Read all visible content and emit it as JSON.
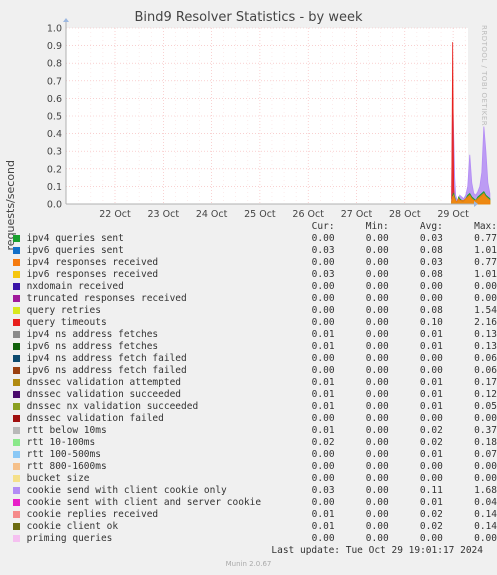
{
  "chart_data": {
    "type": "area",
    "title": "Bind9 Resolver Statistics - by week",
    "ylabel": "requests/second",
    "xlabel": "",
    "ylim": [
      0,
      1.0
    ],
    "y_ticks": [
      "0.0",
      "0.1",
      "0.2",
      "0.3",
      "0.4",
      "0.5",
      "0.6",
      "0.7",
      "0.8",
      "0.9",
      "1.0"
    ],
    "x_ticks": [
      "22 Oct",
      "23 Oct",
      "24 Oct",
      "25 Oct",
      "26 Oct",
      "27 Oct",
      "28 Oct",
      "29 Oct"
    ],
    "grid": true,
    "colors": {
      "background": "#f0f0f0",
      "plot_background": "#ffffff",
      "grid": "#f5b5b5",
      "axis": "#b0b0b0"
    },
    "x": [
      "29 Oct 00:00",
      "29 Oct 00:30",
      "29 Oct 01:00",
      "29 Oct 01:30",
      "29 Oct 02:00",
      "29 Oct 02:30",
      "29 Oct 03:00",
      "29 Oct 03:30",
      "29 Oct 04:00",
      "29 Oct 05:00",
      "29 Oct 06:00",
      "29 Oct 07:00",
      "29 Oct 08:00",
      "29 Oct 09:00",
      "29 Oct 10:00",
      "29 Oct 11:00",
      "29 Oct 12:00",
      "29 Oct 13:00",
      "29 Oct 14:00",
      "29 Oct 15:00",
      "29 Oct 16:00",
      "29 Oct 17:00",
      "29 Oct 18:00",
      "29 Oct 19:00"
    ],
    "series": [
      {
        "name": "cookie send with client cookie only",
        "color": "#b38cf5",
        "values": [
          0.08,
          0.62,
          0.4,
          0.15,
          0.05,
          0.03,
          0.02,
          0.03,
          0.05,
          0.04,
          0.03,
          0.05,
          0.1,
          0.28,
          0.12,
          0.06,
          0.05,
          0.07,
          0.1,
          0.18,
          0.44,
          0.3,
          0.12,
          0.06
        ]
      },
      {
        "name": "query timeouts",
        "color": "#e8201c",
        "values": [
          0.0,
          0.92,
          0.1,
          0.0,
          0.0,
          0.0,
          0.0,
          0.0,
          0.0,
          0.0,
          0.0,
          0.0,
          0.0,
          0.0,
          0.0,
          0.0,
          0.0,
          0.0,
          0.0,
          0.0,
          0.0,
          0.0,
          0.0,
          0.0
        ]
      },
      {
        "name": "ipv4 queries sent",
        "color": "#18a02e",
        "values": [
          0.01,
          0.05,
          0.06,
          0.04,
          0.02,
          0.01,
          0.02,
          0.04,
          0.03,
          0.02,
          0.02,
          0.03,
          0.05,
          0.06,
          0.04,
          0.03,
          0.02,
          0.04,
          0.05,
          0.06,
          0.07,
          0.05,
          0.04,
          0.03
        ]
      },
      {
        "name": "query retries",
        "color": "#d8e81e",
        "values": [
          0.01,
          0.04,
          0.03,
          0.02,
          0.01,
          0.01,
          0.01,
          0.02,
          0.02,
          0.01,
          0.01,
          0.02,
          0.03,
          0.04,
          0.03,
          0.02,
          0.01,
          0.02,
          0.03,
          0.04,
          0.05,
          0.04,
          0.03,
          0.02
        ]
      },
      {
        "name": "ipv4 responses received",
        "color": "#f57a0e",
        "values": [
          0.01,
          0.04,
          0.05,
          0.03,
          0.02,
          0.01,
          0.02,
          0.03,
          0.02,
          0.02,
          0.02,
          0.03,
          0.04,
          0.05,
          0.03,
          0.02,
          0.02,
          0.03,
          0.04,
          0.05,
          0.06,
          0.04,
          0.03,
          0.02
        ]
      }
    ],
    "legend": {
      "headers": [
        "Cur:",
        "Min:",
        "Avg:",
        "Max:"
      ],
      "rows": [
        {
          "name": "ipv4 queries sent",
          "color": "#18a02e",
          "cur": "0.00",
          "min": "0.00",
          "avg": "0.03",
          "max": "0.77"
        },
        {
          "name": "ipv6 queries sent",
          "color": "#1270c8",
          "cur": "0.03",
          "min": "0.00",
          "avg": "0.08",
          "max": "1.01"
        },
        {
          "name": "ipv4 responses received",
          "color": "#f57a0e",
          "cur": "0.00",
          "min": "0.00",
          "avg": "0.03",
          "max": "0.77"
        },
        {
          "name": "ipv6 responses received",
          "color": "#f5c60e",
          "cur": "0.03",
          "min": "0.00",
          "avg": "0.08",
          "max": "1.01"
        },
        {
          "name": "nxdomain received",
          "color": "#3a14a8",
          "cur": "0.00",
          "min": "0.00",
          "avg": "0.00",
          "max": "0.00"
        },
        {
          "name": "truncated responses received",
          "color": "#a01a9a",
          "cur": "0.00",
          "min": "0.00",
          "avg": "0.00",
          "max": "0.00"
        },
        {
          "name": "query retries",
          "color": "#d8e81e",
          "cur": "0.00",
          "min": "0.00",
          "avg": "0.08",
          "max": "1.54"
        },
        {
          "name": "query timeouts",
          "color": "#e8201c",
          "cur": "0.00",
          "min": "0.00",
          "avg": "0.10",
          "max": "2.16"
        },
        {
          "name": "ipv4 ns address fetches",
          "color": "#8a8a8a",
          "cur": "0.01",
          "min": "0.00",
          "avg": "0.01",
          "max": "0.13"
        },
        {
          "name": "ipv6 ns address fetches",
          "color": "#10600a",
          "cur": "0.01",
          "min": "0.00",
          "avg": "0.01",
          "max": "0.13"
        },
        {
          "name": "ipv4 ns address fetch failed",
          "color": "#0c4a6e",
          "cur": "0.00",
          "min": "0.00",
          "avg": "0.00",
          "max": "0.06"
        },
        {
          "name": "ipv6 ns address fetch failed",
          "color": "#9a4010",
          "cur": "0.00",
          "min": "0.00",
          "avg": "0.00",
          "max": "0.06"
        },
        {
          "name": "dnssec validation attempted",
          "color": "#b08a10",
          "cur": "0.01",
          "min": "0.00",
          "avg": "0.01",
          "max": "0.17"
        },
        {
          "name": "dnssec validation succeeded",
          "color": "#4a0a6a",
          "cur": "0.01",
          "min": "0.00",
          "avg": "0.01",
          "max": "0.12"
        },
        {
          "name": "dnssec nx validation succeeded",
          "color": "#8aa020",
          "cur": "0.01",
          "min": "0.00",
          "avg": "0.01",
          "max": "0.05"
        },
        {
          "name": "dnssec validation failed",
          "color": "#a01010",
          "cur": "0.00",
          "min": "0.00",
          "avg": "0.00",
          "max": "0.00"
        },
        {
          "name": "rtt below 10ms",
          "color": "#b8b8b8",
          "cur": "0.01",
          "min": "0.00",
          "avg": "0.02",
          "max": "0.37"
        },
        {
          "name": "rtt 10-100ms",
          "color": "#8ae88a",
          "cur": "0.02",
          "min": "0.00",
          "avg": "0.02",
          "max": "0.18"
        },
        {
          "name": "rtt 100-500ms",
          "color": "#8ac8f5",
          "cur": "0.00",
          "min": "0.00",
          "avg": "0.01",
          "max": "0.07"
        },
        {
          "name": "rtt 800-1600ms",
          "color": "#f5c08a",
          "cur": "0.00",
          "min": "0.00",
          "avg": "0.00",
          "max": "0.00"
        },
        {
          "name": "bucket size",
          "color": "#f5e08a",
          "cur": "0.00",
          "min": "0.00",
          "avg": "0.00",
          "max": "0.00"
        },
        {
          "name": "cookie send with client cookie only",
          "color": "#b38cf5",
          "cur": "0.03",
          "min": "0.00",
          "avg": "0.11",
          "max": "1.68"
        },
        {
          "name": "cookie sent with client and server cookie",
          "color": "#e820c8",
          "cur": "0.00",
          "min": "0.00",
          "avg": "0.01",
          "max": "0.04"
        },
        {
          "name": "cookie replies received",
          "color": "#f58a8a",
          "cur": "0.01",
          "min": "0.00",
          "avg": "0.02",
          "max": "0.14"
        },
        {
          "name": "cookie client ok",
          "color": "#6a6a10",
          "cur": "0.01",
          "min": "0.00",
          "avg": "0.02",
          "max": "0.14"
        },
        {
          "name": "priming queries",
          "color": "#f5c0f0",
          "cur": "0.00",
          "min": "0.00",
          "avg": "0.00",
          "max": "0.00"
        }
      ]
    }
  },
  "side_label": "RRDTOOL / TOBI OETIKER",
  "last_update": "Last update: Tue Oct 29 19:01:17 2024",
  "munin_version": "Munin 2.0.67"
}
